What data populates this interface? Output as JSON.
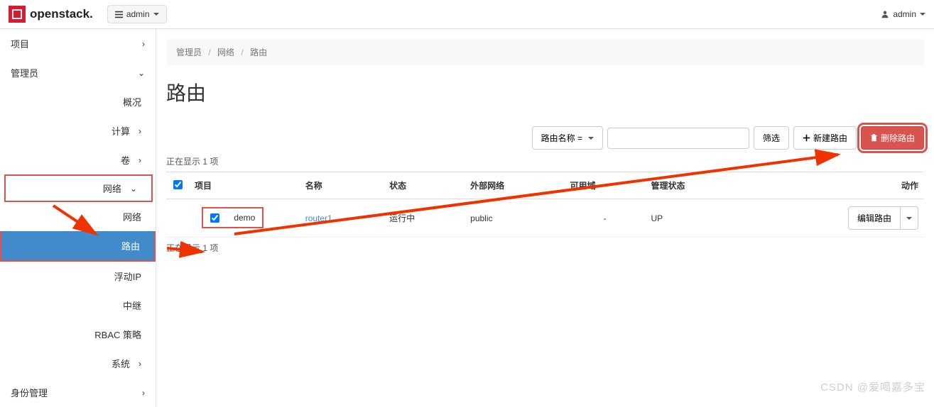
{
  "brand": "openstack.",
  "domain_selector": "admin",
  "user_menu": "admin",
  "sidebar": {
    "project": "项目",
    "admin": "管理员",
    "overview": "概况",
    "compute": "计算",
    "volume": "卷",
    "network": "网络",
    "network_sub": "网络",
    "router": "路由",
    "floating_ip": "浮动IP",
    "relay": "中继",
    "rbac": "RBAC 策略",
    "system": "系统",
    "identity": "身份管理"
  },
  "breadcrumb": {
    "a": "管理员",
    "b": "网络",
    "c": "路由"
  },
  "page_title": "路由",
  "toolbar": {
    "filter_type": "路由名称 =",
    "search_placeholder": "",
    "filter_btn": "筛选",
    "create_btn": "新建路由",
    "delete_btn": "删除路由"
  },
  "count_top": "正在显示 1 项",
  "count_bottom": "正在显示 1 项",
  "columns": {
    "project": "项目",
    "name": "名称",
    "status": "状态",
    "ext_net": "外部网络",
    "az": "可用域",
    "admin_state": "管理状态",
    "actions": "动作"
  },
  "row": {
    "project": "demo",
    "name": "router1",
    "status": "运行中",
    "ext_net": "public",
    "az": "-",
    "admin_state": "UP",
    "action_btn": "编辑路由"
  },
  "watermark": "CSDN @爱喝嘉多宝"
}
